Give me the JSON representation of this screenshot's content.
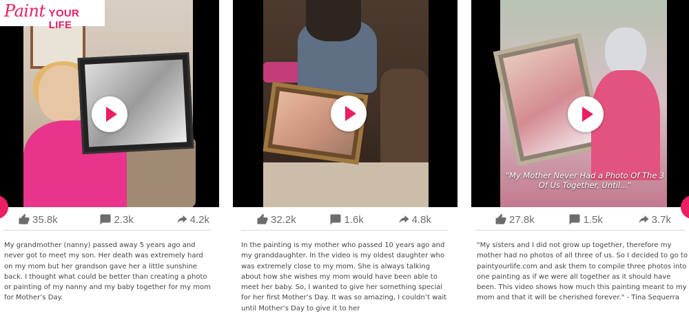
{
  "logo": {
    "word1": "Paint",
    "word2": "YOUR LIFE"
  },
  "accent_color": "#e91e63",
  "cards": [
    {
      "likes": "35.8k",
      "comments": "2.3k",
      "shares": "4.2k",
      "description": "My grandmother (nanny) passed away 5 years ago and never got to meet my son. Her death was extremely hard on my mom but her grandson gave her a little sunshine back. I thought what could be better than creating a photo or painting of my nanny and my baby together for my mom for Mother’s Day."
    },
    {
      "likes": "32.2k",
      "comments": "1.6k",
      "shares": "4.8k",
      "description": "In the painting is my mother who passed 10 years ago and my granddaughter. In the video is my oldest daughter who was extremely close to my mom. She is always talking about how she wishes my mom would have been able to meet her baby. So, I wanted to give her something special for her first Mother’s Day. It was so amazing, I couldn’t wait until Mother’s Day to give it to her"
    },
    {
      "likes": "27.8k",
      "comments": "1.5k",
      "shares": "3.7k",
      "video_caption": "\"My Mother Never Had a Photo Of The 3 Of Us Together, Until...\"",
      "description": "\"My sisters and I did not grow up together, therefore my mother had no photos of all three of us. So I decided to go to paintyourlife.com and ask them to compile three photos into one painting as if we were all together as it should have been. This video shows how much this painting meant to my mom and that it will be cherished forever.\" - Tina Sequerra"
    }
  ],
  "icons": {
    "like": "thumbs-up-icon",
    "comment": "comment-icon",
    "share": "share-icon",
    "play": "play-icon"
  }
}
